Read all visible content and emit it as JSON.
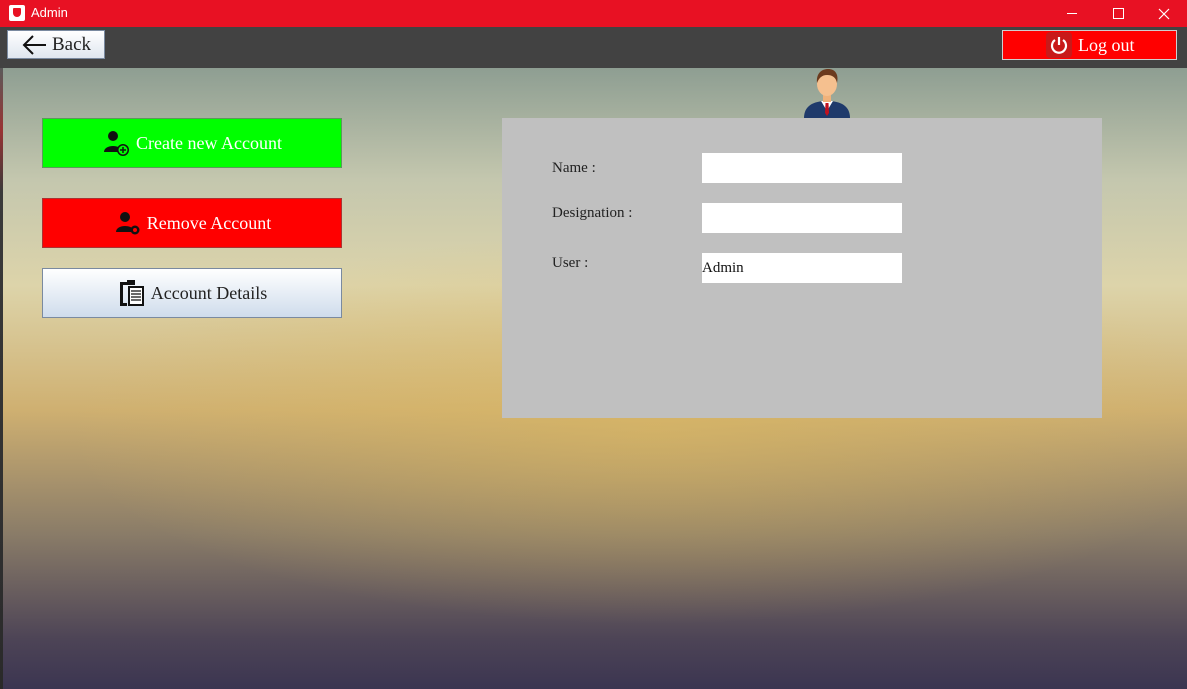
{
  "window": {
    "title": "Admin",
    "controls": {
      "minimize": "minimize",
      "maximize": "maximize",
      "close": "close"
    }
  },
  "toolbar": {
    "back_label": "Back",
    "logout_label": "Log out"
  },
  "actions": {
    "create_label": "Create new Account",
    "remove_label": "Remove Account",
    "details_label": "Account Details"
  },
  "form": {
    "name_label": "Name :",
    "name_value": "",
    "designation_label": "Designation :",
    "designation_value": "",
    "user_label": "User :",
    "user_value": "Admin"
  },
  "colors": {
    "titlebar": "#e81123",
    "toolbar": "#424242",
    "create_button": "#00ff00",
    "remove_button": "#ff0000",
    "logout_button": "#ff0000",
    "panel": "#c0c0c0"
  },
  "icons": {
    "app": "java-app-icon",
    "back": "left-arrow-icon",
    "logout": "power-icon",
    "create": "add-user-icon",
    "remove": "remove-user-icon",
    "details": "clipboard-document-icon",
    "avatar": "businessman-avatar-icon"
  }
}
